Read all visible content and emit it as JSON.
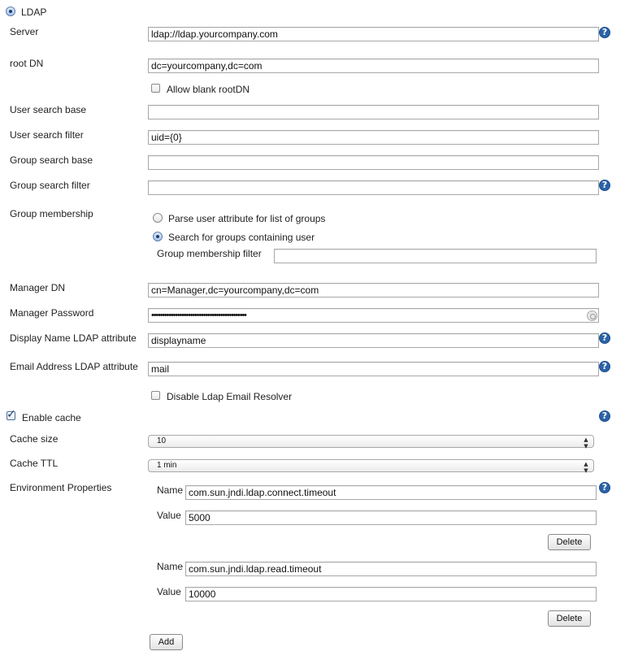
{
  "ldap": {
    "radio_label": "LDAP",
    "server_label": "Server",
    "server_value": "ldap://ldap.yourcompany.com",
    "root_dn_label": "root DN",
    "root_dn_value": "dc=yourcompany,dc=com",
    "allow_blank_rootdn_label": "Allow blank rootDN",
    "user_search_base_label": "User search base",
    "user_search_base_value": "",
    "user_search_filter_label": "User search filter",
    "user_search_filter_value": "uid={0}",
    "group_search_base_label": "Group search base",
    "group_search_base_value": "",
    "group_search_filter_label": "Group search filter",
    "group_search_filter_value": "",
    "group_membership_label": "Group membership",
    "parse_user_attr_label": "Parse user attribute for list of groups",
    "search_groups_label": "Search for groups containing user",
    "group_membership_filter_label": "Group membership filter",
    "group_membership_filter_value": "",
    "manager_dn_label": "Manager DN",
    "manager_dn_value": "cn=Manager,dc=yourcompany,dc=com",
    "manager_password_label": "Manager Password",
    "manager_password_value": "••••••••••••••••••••••••••••••••••••••••••••",
    "display_name_attr_label": "Display Name LDAP attribute",
    "display_name_attr_value": "displayname",
    "email_attr_label": "Email Address LDAP attribute",
    "email_attr_value": "mail",
    "disable_email_resolver_label": "Disable Ldap Email Resolver",
    "enable_cache_label": "Enable cache",
    "cache_size_label": "Cache size",
    "cache_size_value": "10",
    "cache_ttl_label": "Cache TTL",
    "cache_ttl_value": "1 min",
    "env_props_label": "Environment Properties",
    "env_props": [
      {
        "name_label": "Name",
        "name_value": "com.sun.jndi.ldap.connect.timeout",
        "value_label": "Value",
        "value_value": "5000",
        "delete_label": "Delete"
      },
      {
        "name_label": "Name",
        "name_value": "com.sun.jndi.ldap.read.timeout",
        "value_label": "Value",
        "value_value": "10000",
        "delete_label": "Delete"
      }
    ],
    "add_label": "Add",
    "help_glyph": "?",
    "select_arrows": "▲▼"
  },
  "colors": {
    "help_icon": "#2b63a8",
    "border": "#a8a8a8"
  }
}
